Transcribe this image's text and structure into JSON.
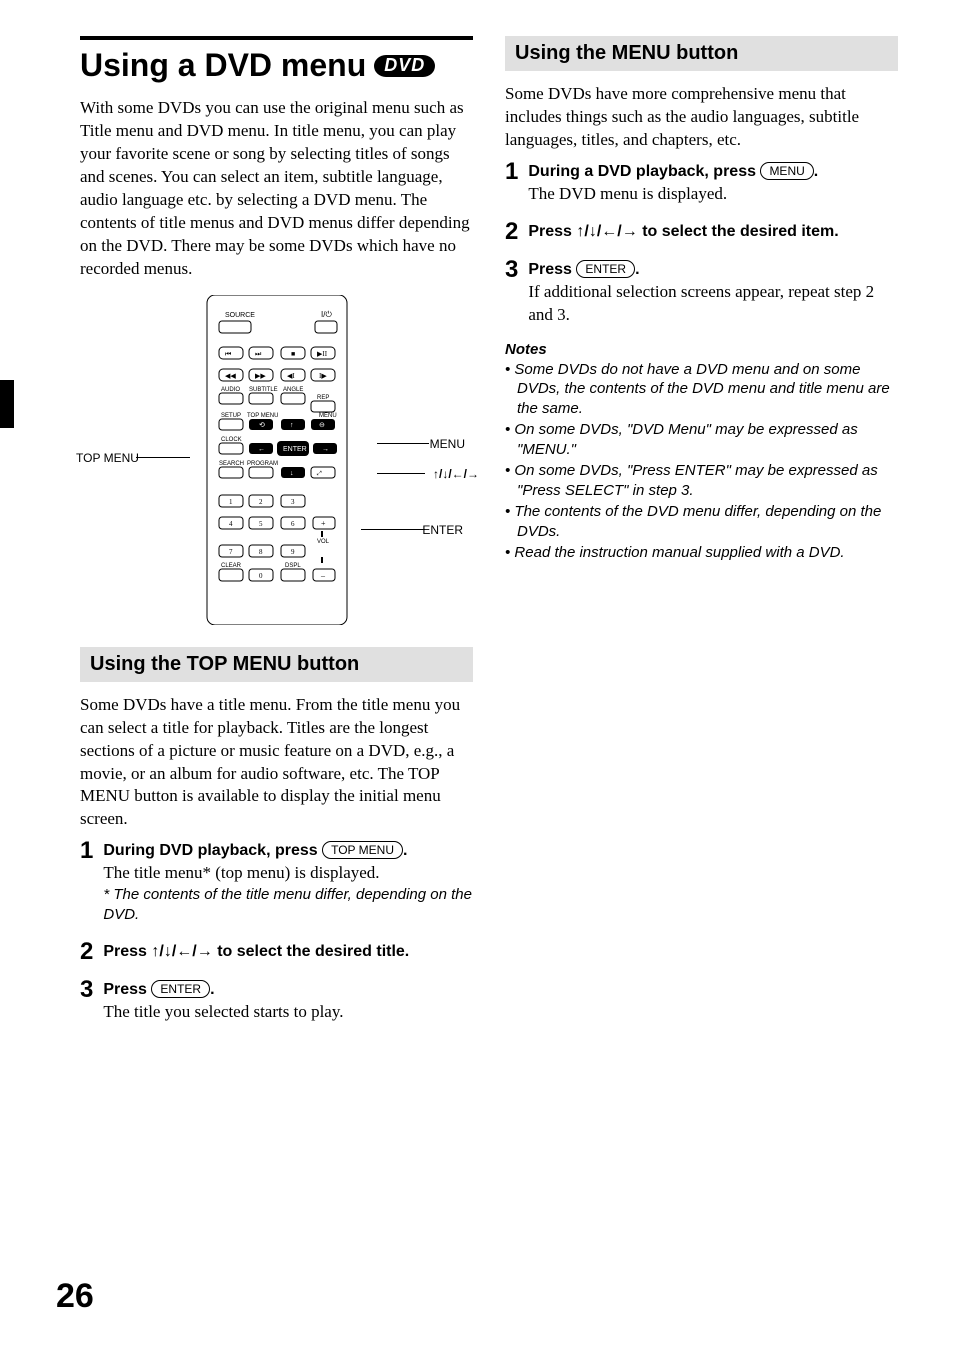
{
  "left": {
    "title": "Using a DVD menu",
    "dvd_logo": "DVD",
    "intro": "With some DVDs you can use the original menu such as Title menu and DVD menu. In title menu, you can play your favorite scene or song  by selecting titles of songs and scenes. You can select an item, subtitle language, audio language etc. by selecting a DVD menu. The contents of title menus and DVD menus differ depending on the DVD. There may be some DVDs which have no recorded menus.",
    "callouts": {
      "topmenu": "TOP MENU",
      "menu": "MENU",
      "arrows": "M/m/</,",
      "enter": "ENTER"
    },
    "section": "Using the TOP MENU button",
    "section_body": "Some DVDs have a title menu. From the title menu you can select a title for playback. Titles are the longest sections of a picture or music feature on a DVD, e.g., a movie, or an album for audio software, etc. The TOP MENU button is available to display the initial menu screen.",
    "steps": [
      {
        "num": "1",
        "lead_before": "During DVD playback, press ",
        "pill": "TOP MENU",
        "lead_after": ".",
        "body": "The title menu* (top menu) is displayed.",
        "foot_pre": "*",
        "foot": "The contents of the title menu differ, depending on the DVD."
      },
      {
        "num": "2",
        "lead_before": "Press ",
        "arrows": "↑/↓/←/→",
        "lead_after": " to select the desired title."
      },
      {
        "num": "3",
        "lead_before": "Press ",
        "pill": "ENTER",
        "lead_after": ".",
        "body": "The title you selected starts to play."
      }
    ]
  },
  "right": {
    "section": "Using the MENU button",
    "section_body": "Some DVDs have more comprehensive menu that includes things such as the audio languages, subtitle languages, titles, and chapters, etc.",
    "steps": [
      {
        "num": "1",
        "lead_before": "During a DVD playback, press ",
        "pill": "MENU",
        "lead_after": ".",
        "body": "The DVD menu is displayed."
      },
      {
        "num": "2",
        "lead_before": "Press ",
        "arrows": "↑/↓/←/→",
        "lead_after": " to select the desired item."
      },
      {
        "num": "3",
        "lead_before": "Press ",
        "pill": "ENTER",
        "lead_after": ".",
        "body": "If additional selection screens appear, repeat step 2 and 3."
      }
    ],
    "notes_heading": "Notes",
    "notes": [
      "Some DVDs do not have a DVD menu and on some DVDs, the contents of the DVD menu and title menu are the same.",
      "On some DVDs, \"DVD Menu\" may be expressed as \"MENU.\"",
      "On some DVDs, \"Press ENTER\" may be expressed as  \"Press SELECT\" in step 3.",
      "The contents of the DVD menu differ, depending on the DVDs.",
      "Read the instruction manual supplied with a DVD."
    ]
  },
  "page_number": "26",
  "remote": {
    "labels": {
      "source": "SOURCE",
      "audio": "AUDIO",
      "subtitle": "SUBTITLE",
      "angle": "ANGLE",
      "rep": "REP",
      "setup": "SETUP",
      "topmenu": "TOP MENU",
      "menu": "MENU",
      "clock": "CLOCK",
      "enter": "ENTER",
      "search": "SEARCH",
      "program": "PROGRAM",
      "vol": "VOL",
      "clear": "CLEAR",
      "dspl": "DSPL"
    }
  }
}
